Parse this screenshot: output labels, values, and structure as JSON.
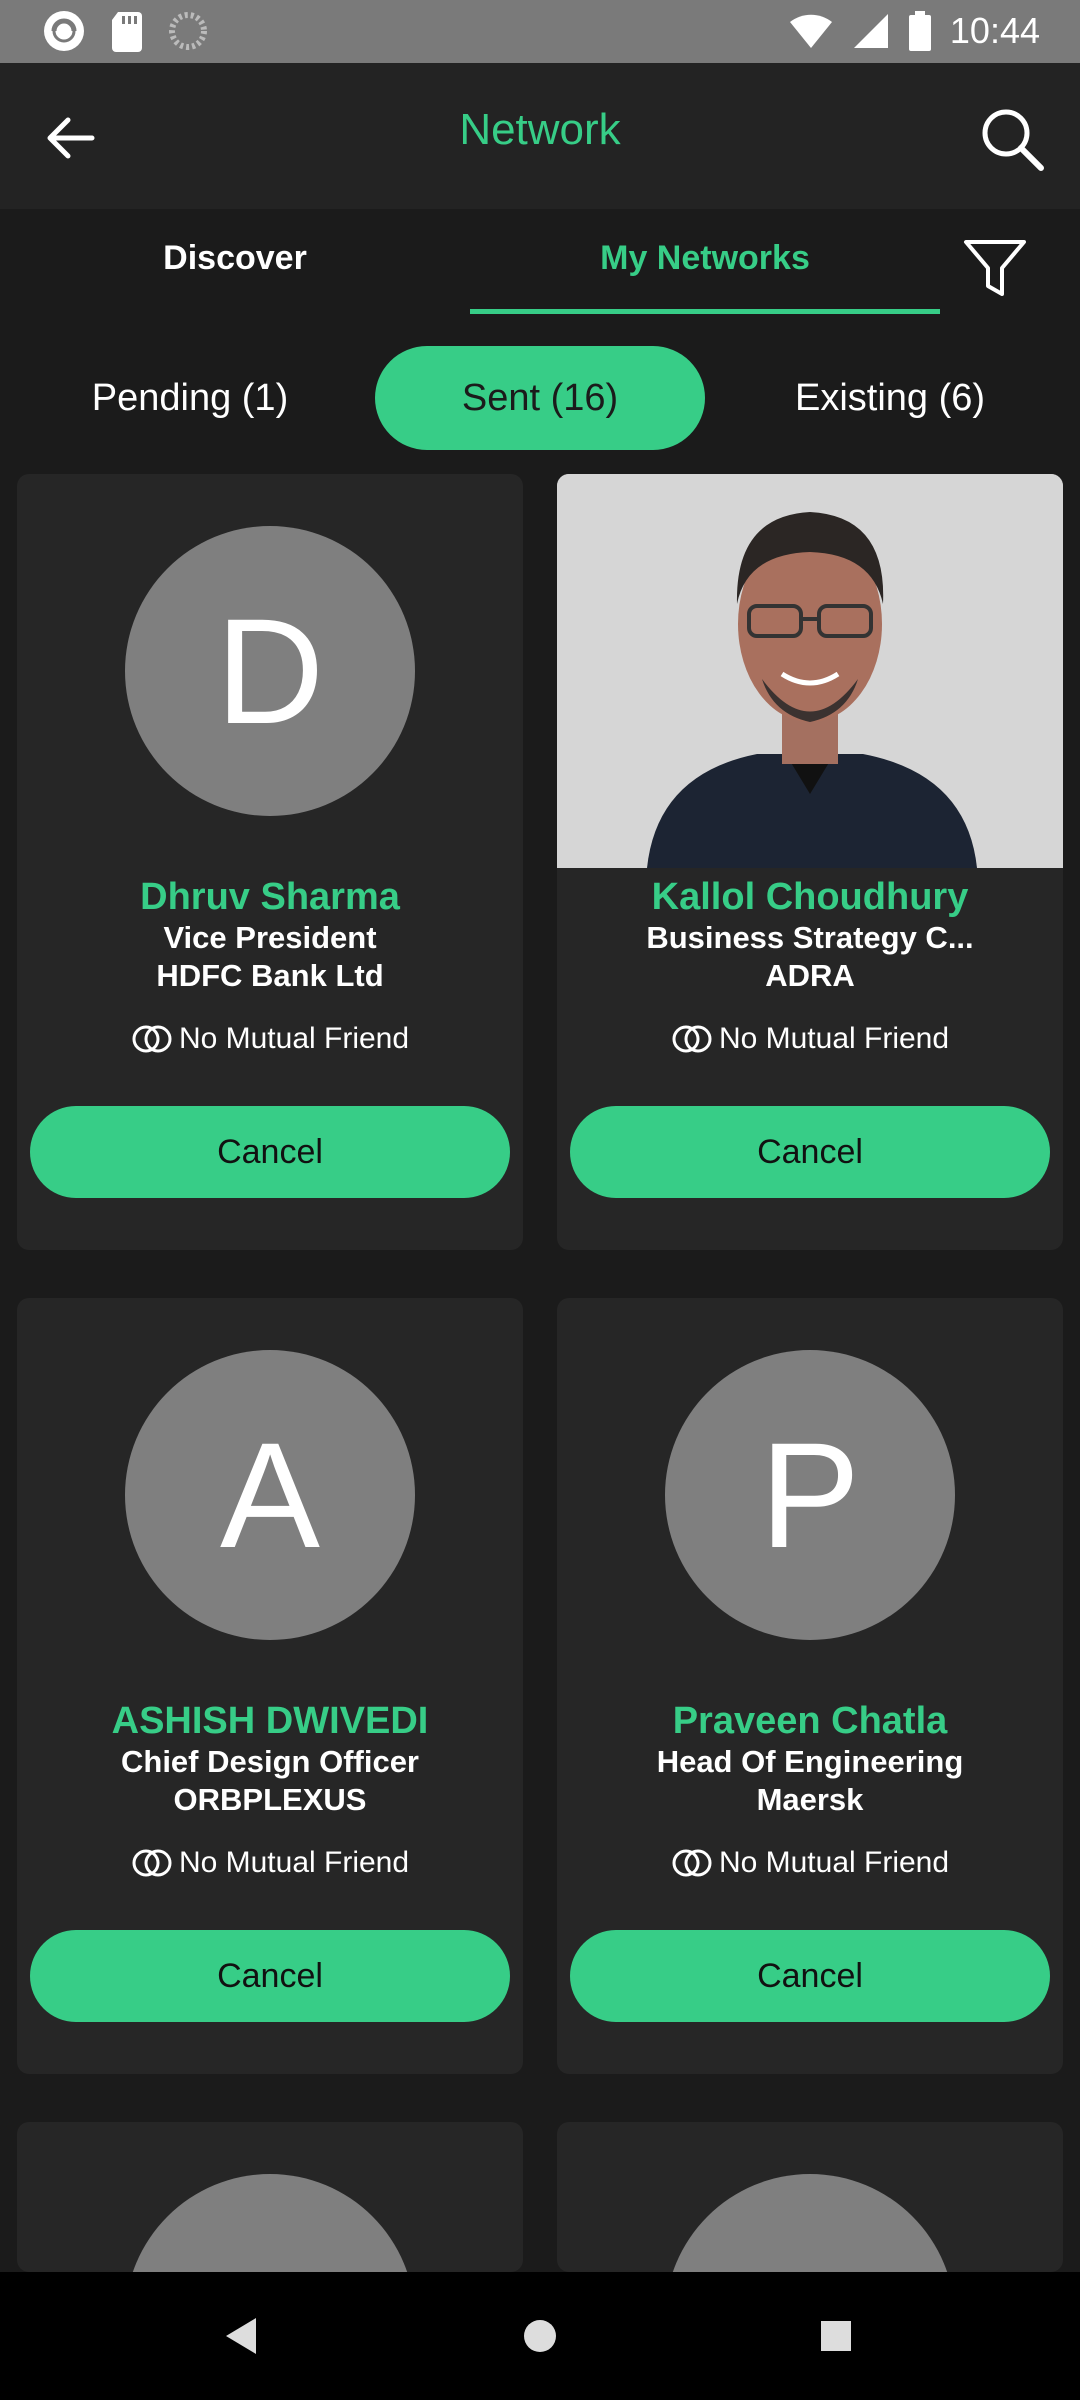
{
  "status_bar": {
    "time": "10:44",
    "left_icons": [
      "app-icon",
      "sd-card-icon",
      "loading-icon"
    ],
    "right_icons": [
      "wifi-icon",
      "signal-icon",
      "battery-icon"
    ]
  },
  "app_bar": {
    "title": "Network",
    "back_icon": "back-arrow-icon",
    "search_icon": "search-icon"
  },
  "tabs": [
    {
      "label": "Discover",
      "active": false
    },
    {
      "label": "My Networks",
      "active": true
    }
  ],
  "filter_icon": "filter-icon",
  "chips": [
    {
      "label": "Pending (1)",
      "active": false
    },
    {
      "label": "Sent (16)",
      "active": true
    },
    {
      "label": "Existing (6)",
      "active": false
    }
  ],
  "cards": [
    {
      "initial": "D",
      "name": "Dhruv Sharma",
      "role": "Vice President",
      "company": "HDFC Bank Ltd",
      "mutual": "No Mutual Friend",
      "action": "Cancel",
      "has_photo": false
    },
    {
      "initial": "",
      "name": "Kallol Choudhury",
      "role": "Business Strategy C...",
      "company": "ADRA",
      "mutual": "No Mutual Friend",
      "action": "Cancel",
      "has_photo": true
    },
    {
      "initial": "A",
      "name": "ASHISH DWIVEDI",
      "role": "Chief Design Officer",
      "company": "ORBPLEXUS",
      "mutual": "No Mutual Friend",
      "action": "Cancel",
      "has_photo": false
    },
    {
      "initial": "P",
      "name": "Praveen Chatla",
      "role": "Head Of Engineering",
      "company": "Maersk",
      "mutual": "No Mutual Friend",
      "action": "Cancel",
      "has_photo": false
    }
  ],
  "colors": {
    "accent": "#37cd87",
    "background": "#1b1b1b",
    "card": "#262626",
    "avatar": "#7f7f7f"
  },
  "nav_bar": [
    "nav-back-icon",
    "nav-home-icon",
    "nav-recents-icon"
  ]
}
